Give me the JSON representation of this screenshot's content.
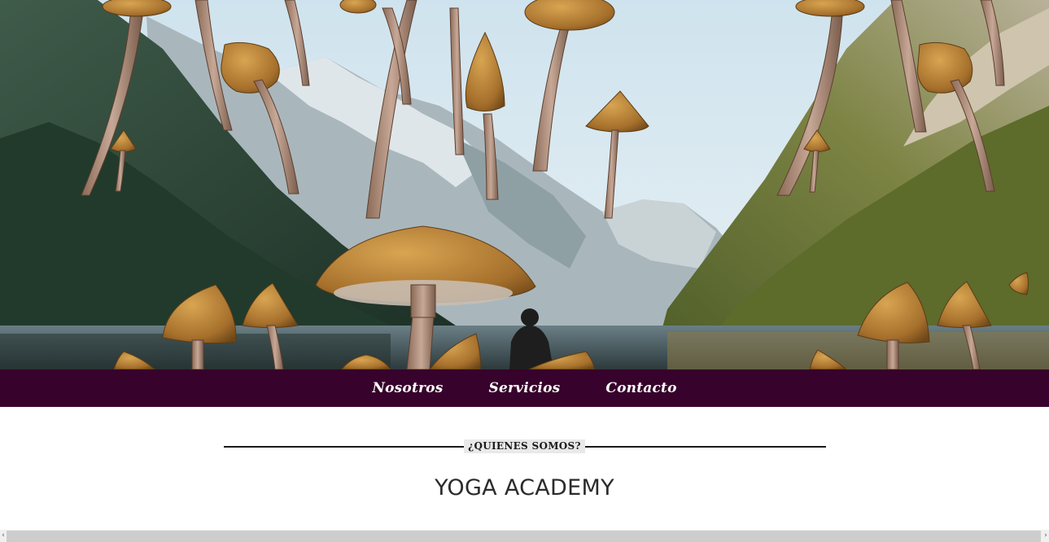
{
  "nav": {
    "items": [
      {
        "label": "Nosotros"
      },
      {
        "label": "Servicios"
      },
      {
        "label": "Contacto"
      }
    ]
  },
  "about": {
    "kicker": "¿QUIENES SOMOS?",
    "title": "YOGA ACADEMY"
  },
  "scrollbar": {
    "left_arrow": "‹",
    "right_arrow": "›"
  },
  "colors": {
    "nav_background": "#37022b",
    "nav_text": "#ffffff",
    "title_text": "#2b2b2b"
  }
}
